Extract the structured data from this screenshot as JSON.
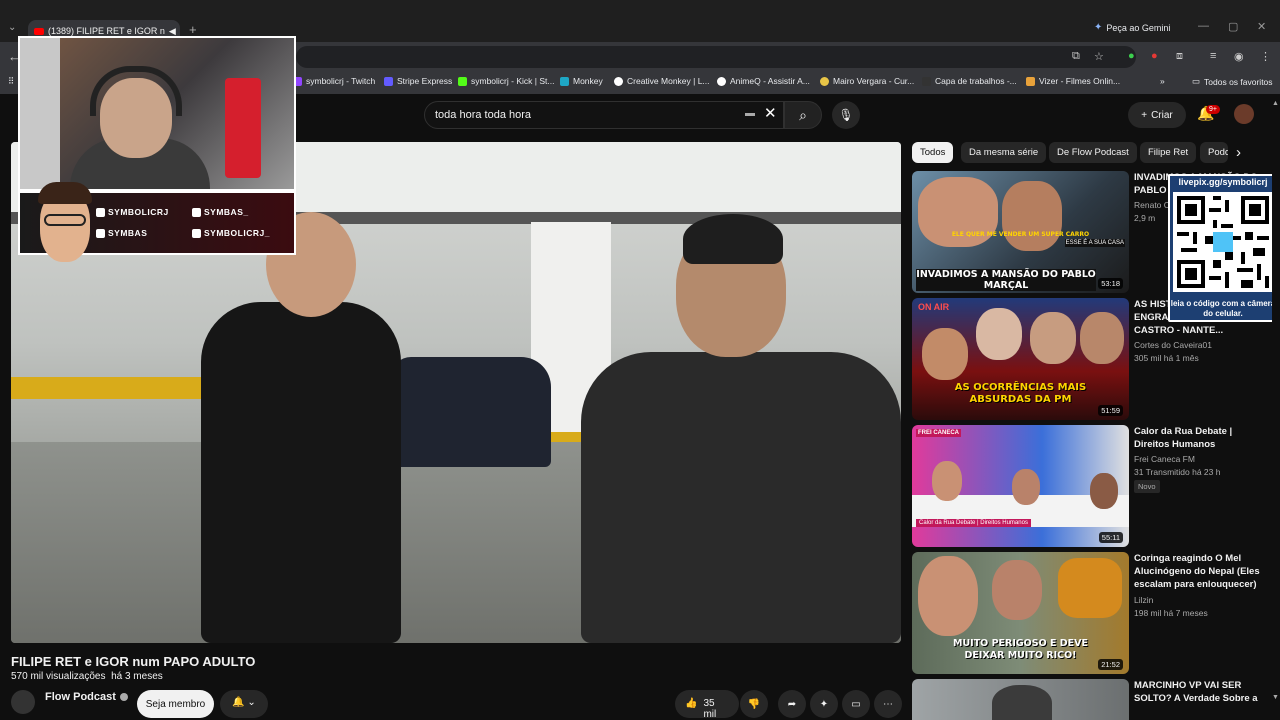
{
  "browser": {
    "tab_title": "(1389) FILIPE RET e IGOR n",
    "gemini_label": "Peça ao Gemini",
    "bookmarks": [
      {
        "label": "symbolicrj - Twitch",
        "color": "#9146ff"
      },
      {
        "label": "Stripe Express",
        "color": "#635bff"
      },
      {
        "label": "symbolicrj - Kick | St...",
        "color": "#53fc18"
      },
      {
        "label": "Monkey",
        "color": "#1ea7c5"
      },
      {
        "label": "Creative Monkey | L...",
        "color": "#ffffff"
      },
      {
        "label": "AnimeQ - Assistir A...",
        "color": "#ffffff"
      },
      {
        "label": "Mairo Vergara - Cur...",
        "color": "#e8c547"
      },
      {
        "label": "Capa de trabalhos -...",
        "color": "#333333"
      },
      {
        "label": "Vizer - Filmes Onlin...",
        "color": "#e8a23a"
      }
    ],
    "favorites_label": "Todos os favoritos"
  },
  "header": {
    "search_query": "toda hora toda hora",
    "create_label": "Criar",
    "notif_badge": "9+"
  },
  "overlay": {
    "socials": [
      {
        "label": "SYMBOLICRJ",
        "icon": "twitch-icon"
      },
      {
        "label": "SYMBAS_",
        "icon": "tiktok-icon"
      },
      {
        "label": "SYMBAS",
        "icon": "youtube-icon"
      },
      {
        "label": "SYMBOLICRJ_",
        "icon": "instagram-icon"
      }
    ],
    "qr_url": "livepix.gg/symbolicrj",
    "qr_caption": "leia o código com a câmera do celular."
  },
  "video": {
    "title": "FILIPE RET e IGOR num PAPO ADULTO",
    "views": "570 mil visualizações",
    "age": "há 3 meses",
    "channel": "Flow Podcast",
    "join_label": "Seja membro",
    "likes": "35 mil"
  },
  "chips": [
    "Todos",
    "Da mesma série",
    "De Flow Podcast",
    "Filipe Ret",
    "Podcasts"
  ],
  "recommendations": [
    {
      "title": "INVADIMOS A MANSÃO DO PABLO MARÇAL",
      "channel": "Renato C",
      "meta": "2,9 m",
      "duration": "53:18",
      "thumb_text": "INVADIMOS A MANSÃO DO PABLO MARÇAL",
      "thumb_sub": "ELE QUER ME VENDER UM SUPER CARRO",
      "thumb_tag": "ESSE É A SUA CASA"
    },
    {
      "title": "AS HISTÓRIAS MAIS ENGRAÇADAS com SGT CASTRO - NANTE...",
      "channel": "Cortes do Caveira01",
      "meta": "305 mil  há 1 mês",
      "duration": "51:59",
      "thumb_text": "AS OCORRÊNCIAS MAIS ABSURDAS DA PM",
      "thumb_sub": "ON AIR"
    },
    {
      "title": "Calor da Rua Debate | Direitos Humanos",
      "channel": "Frei Caneca FM",
      "meta": "31  Transmitido há 23 h",
      "badge": "Novo",
      "duration": "55:11",
      "thumb_text": "Calor da Rua Debate | Direitos Humanos",
      "thumb_sub": "FREI CANECA"
    },
    {
      "title": "Coringa reagindo O Mel Alucinógeno do Nepal (Eles escalam para enlouquecer)",
      "channel": "Lilzin",
      "meta": "198 mil  há 7 meses",
      "duration": "21:52",
      "thumb_text": "MUITO PERIGOSO E DEVE DEIXAR MUITO RICO!"
    },
    {
      "title": "MARCINHO VP VAI SER SOLTO? A Verdade Sobre a"
    }
  ]
}
